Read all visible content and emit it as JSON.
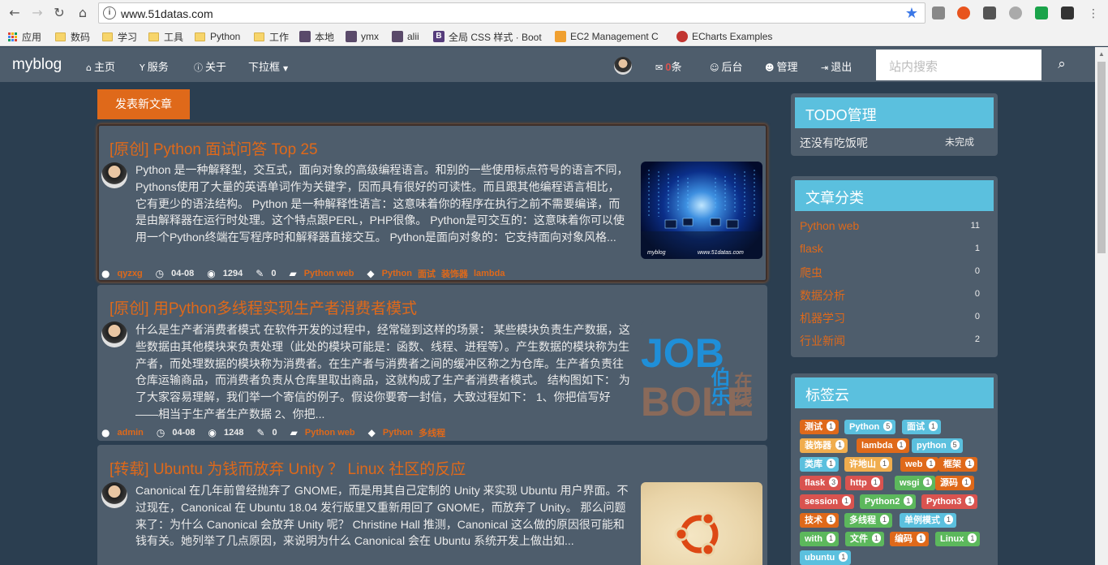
{
  "browser": {
    "url": "www.51datas.com",
    "bookmarks": [
      "应用",
      "数码",
      "学习",
      "工具",
      "Python",
      "工作",
      "本地",
      "ymx",
      "alii",
      "全局 CSS 样式 · Boot",
      "EC2 Management C",
      "ECharts Examples"
    ]
  },
  "navbar": {
    "brand": "myblog",
    "items": [
      "主页",
      "服务",
      "关于",
      "下拉框"
    ],
    "msg_count": "0",
    "msg_suffix": "条",
    "right_items": [
      "后台",
      "管理",
      "退出"
    ],
    "search_placeholder": "站内搜索"
  },
  "main": {
    "new_post_label": "发表新文章",
    "posts": [
      {
        "title": "[原创]  Python 面试问答 Top 25",
        "body": "Python 是一种解释型，交互式，面向对象的高级编程语言。和别的一些使用标点符号的语言不同，Pythons使用了大量的英语单词作为关键字，因而具有很好的可读性。而且跟其他编程语言相比，它有更少的语法结构。 Python 是一种解释性语言：这意味着你的程序在执行之前不需要编译，而是由解释器在运行时处理。这个特点跟PERL，PHP很像。 Python是可交互的：这意味着你可以使用一个Python终端在写程序时和解释器直接交互。 Python是面向对象的：它支持面向对象风格...",
        "author": "qyzxg",
        "date": "04-08",
        "views": "1294",
        "comments": "0",
        "category": "Python web",
        "tags": [
          "Python",
          "面试",
          "装饰器",
          "lambda"
        ],
        "thumb_text": [
          "myblog",
          "www.51datas.com"
        ]
      },
      {
        "title": "[原创]  用Python多线程实现生产者消费者模式",
        "body": "什么是生产者消费者模式 在软件开发的过程中，经常碰到这样的场景： 某些模块负责生产数据，这些数据由其他模块来负责处理（此处的模块可能是：函数、线程、进程等）。产生数据的模块称为生产者，而处理数据的模块称为消费者。在生产者与消费者之间的缓冲区称之为仓库。生产者负责往仓库运输商品，而消费者负责从仓库里取出商品，这就构成了生产者消费者模式。 结构图如下： 为了大家容易理解，我们举一个寄信的例子。假设你要寄一封信，大致过程如下： 1、你把信写好——相当于生产者生产数据 2、你把...",
        "author": "admin",
        "date": "04-08",
        "views": "1248",
        "comments": "0",
        "category": "Python web",
        "tags": [
          "Python",
          "多线程"
        ],
        "thumb_text": [
          "JOB",
          "BOLE",
          "伯乐",
          "在线"
        ]
      },
      {
        "title": "[转载]  Ubuntu 为钱而放弃 Unity ？ Linux 社区的反应",
        "body": "Canonical 在几年前曾经抛弃了 GNOME，而是用其自己定制的 Unity 来实现 Ubuntu 用户界面。不过现在，Canonical 在 Ubuntu 18.04 发行版里又重新用回了 GNOME，而放弃了 Unity。 那么问题来了：为什么 Canonical 会放弃 Unity 呢？ Christine Hall 推测，Canonical 这么做的原因很可能和钱有关。她列举了几点原因，来说明为什么 Canonical 会在 Ubuntu 系统开发上做出如..."
      }
    ]
  },
  "sidebar": {
    "todo": {
      "title": "TODO管理",
      "items": [
        {
          "text": "还没有吃饭呢",
          "status": "未完成"
        }
      ]
    },
    "categories": {
      "title": "文章分类",
      "items": [
        {
          "name": "Python web",
          "count": "11"
        },
        {
          "name": "flask",
          "count": "1"
        },
        {
          "name": "爬虫",
          "count": "0"
        },
        {
          "name": "数据分析",
          "count": "0"
        },
        {
          "name": "机器学习",
          "count": "0"
        },
        {
          "name": "行业新闻",
          "count": "2"
        }
      ]
    },
    "tagcloud": {
      "title": "标签云",
      "tags": [
        {
          "name": "测试",
          "count": "1",
          "color": "#df691a"
        },
        {
          "name": "Python",
          "count": "5",
          "color": "#5bc0de"
        },
        {
          "name": "面试",
          "count": "1",
          "color": "#5bc0de"
        },
        {
          "name": "装饰器",
          "count": "1",
          "color": "#f0ad4e"
        },
        {
          "name": "lambda",
          "count": "1",
          "color": "#df691a"
        },
        {
          "name": "python",
          "count": "5",
          "color": "#5bc0de"
        },
        {
          "name": "类库",
          "count": "1",
          "color": "#5bc0de"
        },
        {
          "name": "许地山",
          "count": "1",
          "color": "#f0ad4e"
        },
        {
          "name": "web",
          "count": "1",
          "color": "#df691a"
        },
        {
          "name": "框架",
          "count": "1",
          "color": "#df691a"
        },
        {
          "name": "flask",
          "count": "3",
          "color": "#d9534f"
        },
        {
          "name": "http",
          "count": "1",
          "color": "#d9534f"
        },
        {
          "name": "wsgi",
          "count": "1",
          "color": "#5cb85c"
        },
        {
          "name": "源码",
          "count": "1",
          "color": "#df691a"
        },
        {
          "name": "session",
          "count": "1",
          "color": "#d9534f"
        },
        {
          "name": "Python2",
          "count": "1",
          "color": "#5cb85c"
        },
        {
          "name": "Python3",
          "count": "1",
          "color": "#d9534f"
        },
        {
          "name": "技术",
          "count": "1",
          "color": "#df691a"
        },
        {
          "name": "多线程",
          "count": "1",
          "color": "#5cb85c"
        },
        {
          "name": "单例模式",
          "count": "1",
          "color": "#5bc0de"
        },
        {
          "name": "with",
          "count": "1",
          "color": "#5cb85c"
        },
        {
          "name": "文件",
          "count": "1",
          "color": "#5cb85c"
        },
        {
          "name": "编码",
          "count": "1",
          "color": "#df691a"
        },
        {
          "name": "Linux",
          "count": "1",
          "color": "#5cb85c"
        },
        {
          "name": "ubuntu",
          "count": "1",
          "color": "#5bc0de"
        }
      ]
    }
  },
  "colors": {
    "accent": "#df691a",
    "info": "#5bc0de",
    "success": "#5cb85c",
    "danger": "#d9534f",
    "warning": "#f0ad4e",
    "panel": "#4e5d6c",
    "bg": "#2b3e50"
  }
}
